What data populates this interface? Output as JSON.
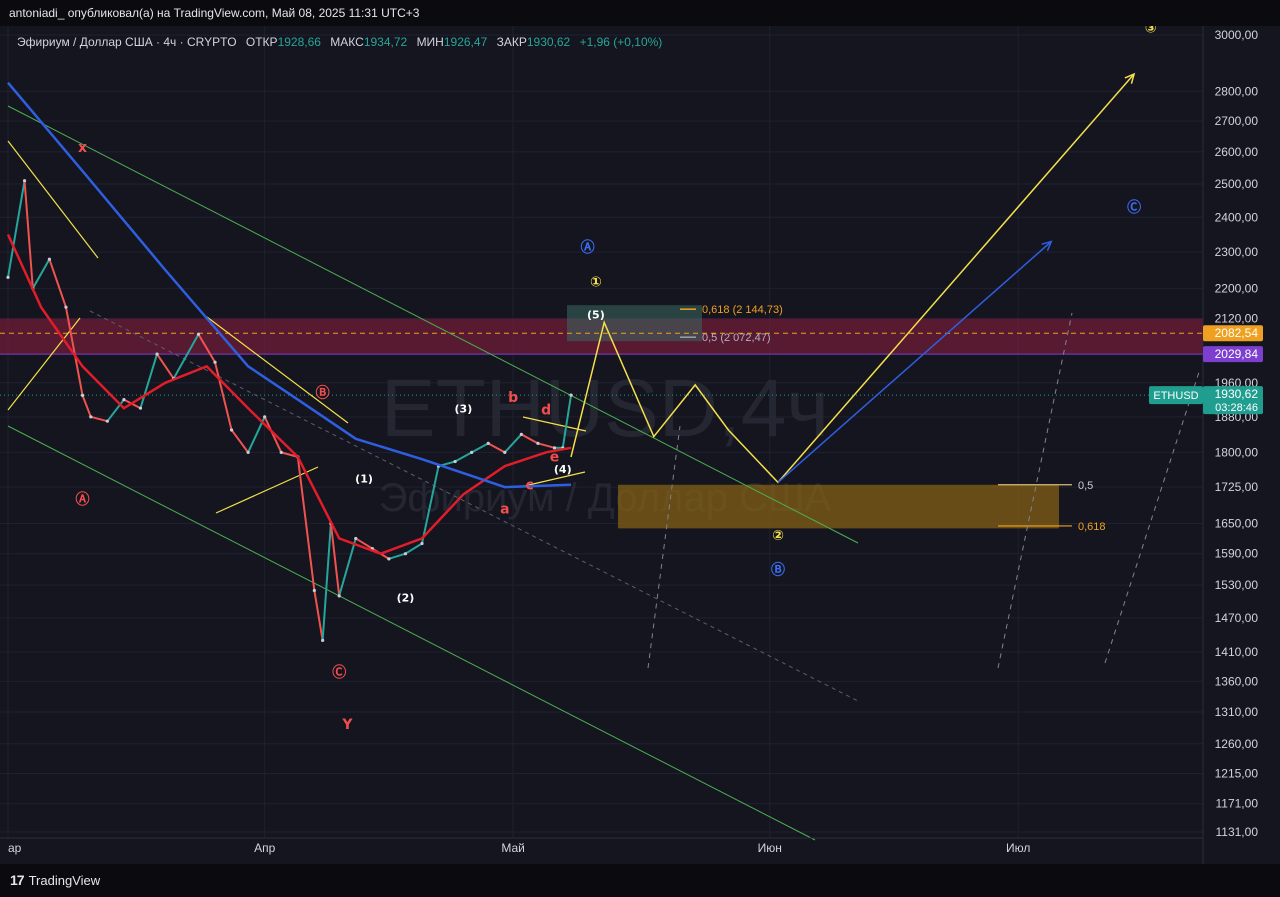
{
  "header": {
    "publisher_line": "antoniadi_ опубликовал(а) на TradingView.com, Май 08, 2025 11:31 UTC+3"
  },
  "legend": {
    "symbol": "Эфириум / Доллар США · 4ч · CRYPTO",
    "open_label": "ОТКР",
    "open": "1928,66",
    "high_label": "МАКС",
    "high": "1934,72",
    "low_label": "МИН",
    "low": "1926,47",
    "close_label": "ЗАКР",
    "close": "1930,62",
    "change": "+1,96 (+0,10%)"
  },
  "watermark": {
    "ticker": "ETHUSD,4ч",
    "name": "Эфириум / Доллар США"
  },
  "footer": {
    "brand": "TradingView"
  },
  "colors": {
    "up": "#26a69a",
    "down": "#ef5350",
    "ma_red": "#e11d2a",
    "ma_blue": "#2f5fe0",
    "wave": "#f3e04a",
    "channel": "#4caf50",
    "resistance_zone": "#8e1f3f",
    "support_zone": "#8a6414",
    "label_red": "#f04e4e",
    "label_blue": "#3c6cf0"
  },
  "chart_data": {
    "type": "candlestick",
    "symbol": "ETHUSD",
    "timeframe": "4ч",
    "y_scale": "log",
    "ylim": [
      1131,
      3000
    ],
    "y_ticks": [
      3000,
      2800,
      2700,
      2600,
      2500,
      2400,
      2300,
      2200,
      2120,
      1960,
      1880,
      1800,
      1725,
      1650,
      1590,
      1530,
      1470,
      1410,
      1360,
      1310,
      1260,
      1215,
      1171,
      1131
    ],
    "y_tick_labels": [
      "3000,00",
      "2800,00",
      "2700,00",
      "2600,00",
      "2500,00",
      "2400,00",
      "2300,00",
      "2200,00",
      "2120,00",
      "1960,00",
      "1880,00",
      "1800,00",
      "1725,00",
      "1650,00",
      "1590,00",
      "1530,00",
      "1470,00",
      "1410,00",
      "1360,00",
      "1310,00",
      "1260,00",
      "1215,00",
      "1171,00",
      "1131,00"
    ],
    "x_tick_labels": [
      "ар",
      "Апр",
      "Май",
      "Июн",
      "Июл"
    ],
    "price_series": [
      [
        "2025-03-01",
        2230
      ],
      [
        "2025-03-03",
        2510
      ],
      [
        "2025-03-04",
        2200
      ],
      [
        "2025-03-06",
        2280
      ],
      [
        "2025-03-08",
        2150
      ],
      [
        "2025-03-10",
        1930
      ],
      [
        "2025-03-11",
        1880
      ],
      [
        "2025-03-13",
        1870
      ],
      [
        "2025-03-15",
        1920
      ],
      [
        "2025-03-17",
        1900
      ],
      [
        "2025-03-19",
        2030
      ],
      [
        "2025-03-21",
        1970
      ],
      [
        "2025-03-24",
        2080
      ],
      [
        "2025-03-26",
        2010
      ],
      [
        "2025-03-28",
        1850
      ],
      [
        "2025-03-30",
        1800
      ],
      [
        "2025-04-01",
        1880
      ],
      [
        "2025-04-03",
        1800
      ],
      [
        "2025-04-05",
        1790
      ],
      [
        "2025-04-07",
        1520
      ],
      [
        "2025-04-08",
        1430
      ],
      [
        "2025-04-09",
        1650
      ],
      [
        "2025-04-10",
        1510
      ],
      [
        "2025-04-12",
        1620
      ],
      [
        "2025-04-14",
        1600
      ],
      [
        "2025-04-16",
        1580
      ],
      [
        "2025-04-18",
        1590
      ],
      [
        "2025-04-20",
        1610
      ],
      [
        "2025-04-22",
        1770
      ],
      [
        "2025-04-24",
        1780
      ],
      [
        "2025-04-26",
        1800
      ],
      [
        "2025-04-28",
        1820
      ],
      [
        "2025-04-30",
        1800
      ],
      [
        "2025-05-02",
        1840
      ],
      [
        "2025-05-04",
        1820
      ],
      [
        "2025-05-06",
        1810
      ],
      [
        "2025-05-07",
        1810
      ],
      [
        "2025-05-08",
        1930.62
      ]
    ],
    "moving_averages": [
      {
        "color": "#e11d2a",
        "points": [
          [
            "2025-03-01",
            2350
          ],
          [
            "2025-03-05",
            2150
          ],
          [
            "2025-03-10",
            2000
          ],
          [
            "2025-03-15",
            1900
          ],
          [
            "2025-03-20",
            1960
          ],
          [
            "2025-03-25",
            2000
          ],
          [
            "2025-03-30",
            1900
          ],
          [
            "2025-04-05",
            1790
          ],
          [
            "2025-04-10",
            1620
          ],
          [
            "2025-04-15",
            1590
          ],
          [
            "2025-04-20",
            1620
          ],
          [
            "2025-04-25",
            1710
          ],
          [
            "2025-04-30",
            1770
          ],
          [
            "2025-05-05",
            1800
          ],
          [
            "2025-05-08",
            1810
          ]
        ]
      },
      {
        "color": "#2f5fe0",
        "points": [
          [
            "2025-03-01",
            2830
          ],
          [
            "2025-03-10",
            2540
          ],
          [
            "2025-03-20",
            2250
          ],
          [
            "2025-03-30",
            2000
          ],
          [
            "2025-04-05",
            1920
          ],
          [
            "2025-04-12",
            1830
          ],
          [
            "2025-04-20",
            1785
          ],
          [
            "2025-04-30",
            1725
          ],
          [
            "2025-05-08",
            1730
          ]
        ]
      }
    ],
    "projections": [
      {
        "name": "",
        "color": "#f3e04a",
        "points": [
          [
            "2025-05-08",
            1790
          ],
          [
            "2025-05-12",
            2110
          ],
          [
            "2025-05-18",
            1835
          ],
          [
            "2025-05-23",
            1955
          ],
          [
            "2025-05-27",
            1850
          ],
          [
            "2025-06-02",
            1735
          ],
          [
            "2025-07-15",
            2860
          ]
        ]
      },
      {
        "name": "",
        "color": "#2f5fe0",
        "points": [
          [
            "2025-06-02",
            1735
          ],
          [
            "2025-07-05",
            2330
          ]
        ]
      }
    ],
    "zones": [
      {
        "type": "resistance",
        "from": 2029.84,
        "to": 2120
      },
      {
        "type": "support",
        "from": 1640,
        "to": 1730
      }
    ],
    "fib_levels": [
      {
        "label": "0,618",
        "value_label": "2 144,73",
        "value": 2144.73
      },
      {
        "label": "0,5",
        "value_label": "2 072,47",
        "value": 2072.47
      },
      {
        "label": "0,5",
        "value": 1730
      },
      {
        "label": "0,618",
        "value": 1645
      }
    ],
    "price_labels": [
      {
        "value": 2082.54,
        "text": "2082,54",
        "color": "#f0a020"
      },
      {
        "value": 2029.84,
        "text": "2029,84",
        "color": "#7c3fd0"
      },
      {
        "value": 1930.62,
        "text": "ETHUSD",
        "price": "1930,62",
        "countdown": "03:28:46",
        "color": "#1f9e8f"
      }
    ],
    "wave_labels": [
      {
        "text": "x",
        "date": "2025-03-10",
        "price": 2600,
        "color": "#f04e4e"
      },
      {
        "text": "Ⓐ",
        "date": "2025-03-10",
        "price": 1690,
        "color": "#f04e4e"
      },
      {
        "text": "Ⓑ",
        "date": "2025-04-08",
        "price": 1925,
        "color": "#f04e4e"
      },
      {
        "text": "Ⓒ",
        "date": "2025-04-10",
        "price": 1367,
        "color": "#f04e4e"
      },
      {
        "text": "Y",
        "date": "2025-04-11",
        "price": 1283,
        "color": "#f04e4e"
      },
      {
        "text": "(1)",
        "date": "2025-04-13",
        "price": 1735,
        "color": "#ffffff"
      },
      {
        "text": "(2)",
        "date": "2025-04-18",
        "price": 1500,
        "color": "#ffffff"
      },
      {
        "text": "(3)",
        "date": "2025-04-25",
        "price": 1890,
        "color": "#ffffff"
      },
      {
        "text": "(4)",
        "date": "2025-05-07",
        "price": 1755,
        "color": "#ffffff"
      },
      {
        "text": "(5)",
        "date": "2025-05-11",
        "price": 2120,
        "color": "#ffffff"
      },
      {
        "text": "a",
        "date": "2025-04-30",
        "price": 1670,
        "color": "#f04e4e"
      },
      {
        "text": "b",
        "date": "2025-05-01",
        "price": 1915,
        "color": "#f04e4e"
      },
      {
        "text": "c",
        "date": "2025-05-03",
        "price": 1720,
        "color": "#f04e4e"
      },
      {
        "text": "d",
        "date": "2025-05-05",
        "price": 1885,
        "color": "#f04e4e"
      },
      {
        "text": "e",
        "date": "2025-05-06",
        "price": 1780,
        "color": "#f04e4e"
      },
      {
        "text": "Ⓐ",
        "date": "2025-05-10",
        "price": 2300,
        "color": "#3c6cf0"
      },
      {
        "text": "Ⓑ",
        "date": "2025-06-02",
        "price": 1550,
        "color": "#3c6cf0"
      },
      {
        "text": "Ⓒ",
        "date": "2025-07-15",
        "price": 2415,
        "color": "#3c6cf0"
      },
      {
        "text": "①",
        "date": "2025-05-11",
        "price": 2205,
        "color": "#f3e04a"
      },
      {
        "text": "②",
        "date": "2025-06-02",
        "price": 1617,
        "color": "#f3e04a"
      },
      {
        "text": "③",
        "date": "2025-07-17",
        "price": 3010,
        "color": "#f3e04a"
      }
    ]
  }
}
